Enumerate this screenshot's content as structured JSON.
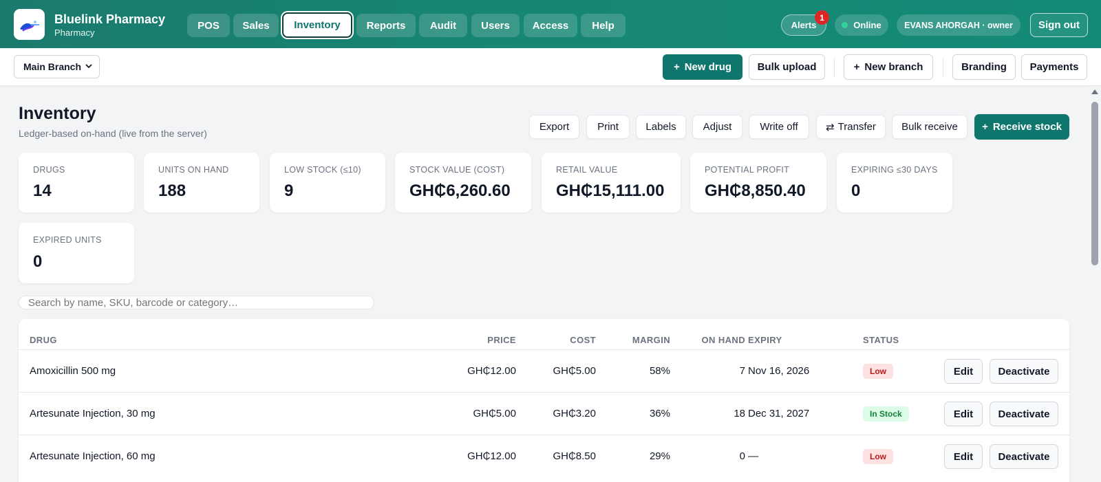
{
  "brand": {
    "name": "Bluelink Pharmacy",
    "sub": "Pharmacy"
  },
  "nav": {
    "items": [
      {
        "label": "POS"
      },
      {
        "label": "Sales"
      },
      {
        "label": "Inventory"
      },
      {
        "label": "Reports"
      },
      {
        "label": "Audit"
      },
      {
        "label": "Users"
      },
      {
        "label": "Access"
      },
      {
        "label": "Help"
      }
    ],
    "active": "Inventory"
  },
  "header": {
    "alerts_label": "Alerts",
    "alerts_count": "1",
    "status_label": "Online",
    "user_label": "EVANS AHORGAH · owner",
    "signout_label": "Sign out"
  },
  "subbar": {
    "branch": "Main Branch",
    "new_drug": "New drug",
    "bulk_upload": "Bulk upload",
    "new_branch": "New branch",
    "branding": "Branding",
    "payments": "Payments"
  },
  "page": {
    "title": "Inventory",
    "subtitle": "Ledger-based on-hand (live from the server)",
    "actions": {
      "export": "Export",
      "print": "Print",
      "labels": "Labels",
      "adjust": "Adjust",
      "write_off": "Write off",
      "transfer": "Transfer",
      "bulk_receive": "Bulk receive",
      "receive_stock": "Receive stock"
    }
  },
  "stats": [
    {
      "label": "DRUGS",
      "value": "14"
    },
    {
      "label": "UNITS ON HAND",
      "value": "188"
    },
    {
      "label": "LOW STOCK (≤10)",
      "value": "9"
    },
    {
      "label": "STOCK VALUE (COST)",
      "value": "GH₵6,260.60"
    },
    {
      "label": "RETAIL VALUE",
      "value": "GH₵15,111.00"
    },
    {
      "label": "POTENTIAL PROFIT",
      "value": "GH₵8,850.40"
    },
    {
      "label": "EXPIRING ≤30 DAYS",
      "value": "0"
    },
    {
      "label": "EXPIRED UNITS",
      "value": "0"
    }
  ],
  "search": {
    "placeholder": "Search by name, SKU, barcode or category…"
  },
  "table": {
    "columns": [
      "DRUG",
      "PRICE",
      "COST",
      "MARGIN",
      "ON HAND",
      "EXPIRY",
      "STATUS"
    ],
    "rows": [
      {
        "drug": "Amoxicillin 500 mg",
        "price": "GH₵12.00",
        "cost": "GH₵5.00",
        "margin": "58%",
        "on_hand": "7",
        "expiry": "Nov 16, 2026",
        "status": "Low",
        "edit": "Edit",
        "deactivate": "Deactivate"
      },
      {
        "drug": "Artesunate Injection, 30 mg",
        "price": "GH₵5.00",
        "cost": "GH₵3.20",
        "margin": "36%",
        "on_hand": "18",
        "expiry": "Dec 31, 2027",
        "status": "In Stock",
        "edit": "Edit",
        "deactivate": "Deactivate"
      },
      {
        "drug": "Artesunate Injection, 60 mg",
        "price": "GH₵12.00",
        "cost": "GH₵8.50",
        "margin": "29%",
        "on_hand": "0",
        "expiry": "—",
        "status": "Low",
        "edit": "Edit",
        "deactivate": "Deactivate"
      }
    ]
  },
  "colors": {
    "brand": "#0f766e",
    "low_bg": "#fee2e2",
    "low_fg": "#b91c1c",
    "instock_bg": "#dcfce7",
    "instock_fg": "#15803d"
  },
  "icons": [
    "logo-icon",
    "chevron-down-icon",
    "plus-icon",
    "transfer-icon",
    "online-dot-icon"
  ]
}
